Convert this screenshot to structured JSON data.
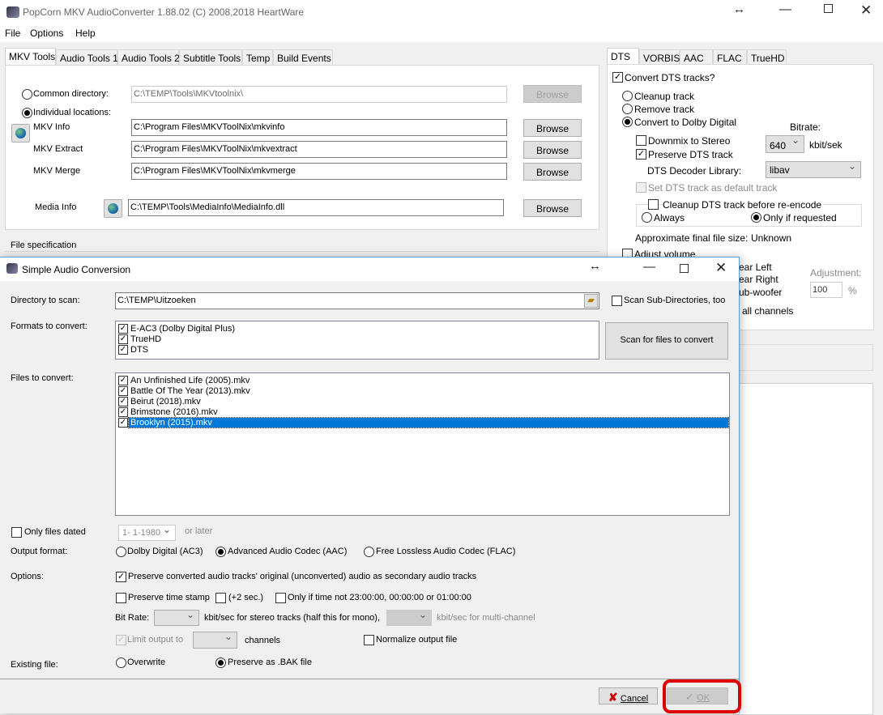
{
  "app": {
    "title": "PopCorn MKV AudioConverter 1.88.02 (C) 2008,2018 HeartWare",
    "menu": [
      "File",
      "Options",
      "Help"
    ]
  },
  "left_tabs": [
    "MKV Tools",
    "Audio Tools 1",
    "Audio Tools 2",
    "Subtitle Tools",
    "Temp",
    "Build Events"
  ],
  "mkv": {
    "common_label": "Common directory:",
    "common_value": "C:\\TEMP\\Tools\\MKVtoolnix\\",
    "individual_label": "Individual locations:",
    "info_label": "MKV Info",
    "info_value": "C:\\Program Files\\MKVToolNix\\mkvinfo",
    "extract_label": "MKV Extract",
    "extract_value": "C:\\Program Files\\MKVToolNix\\mkvextract",
    "merge_label": "MKV Merge",
    "merge_value": "C:\\Program Files\\MKVToolNix\\mkvmerge",
    "mediainfo_label": "Media Info",
    "mediainfo_value": "C:\\TEMP\\Tools\\MediaInfo\\MediaInfo.dll",
    "browse": "Browse"
  },
  "file_spec": "File specification",
  "right_tabs": [
    "DTS",
    "VORBIS",
    "AAC",
    "FLAC",
    "TrueHD"
  ],
  "dts": {
    "convert": "Convert DTS tracks?",
    "cleanup": "Cleanup track",
    "remove": "Remove track",
    "to_dd": "Convert to Dolby Digital",
    "bitrate_label": "Bitrate:",
    "downmix": "Downmix to Stereo",
    "bitrate": "640",
    "unit": "kbit/sek",
    "preserve": "Preserve DTS track",
    "decoder_label": "DTS Decoder Library:",
    "decoder": "libav",
    "set_default": "Set DTS track as default track",
    "cleanup_before": "Cleanup DTS track before re-encode",
    "always": "Always",
    "only_req": "Only if requested",
    "approx_label": "Approximate final file size:",
    "approx": "Unknown",
    "adjust": "Adjust volume",
    "rear_left": "ear Left",
    "rear_right": "ear Right",
    "sub": "ub-woofer",
    "all": "all channels",
    "adjustment": "Adjustment:",
    "adj_value": "100",
    "pct": "%"
  },
  "dialog": {
    "title": "Simple Audio Conversion",
    "dir_label": "Directory to scan:",
    "dir_value": "C:\\TEMP\\Uitzoeken",
    "scan_sub": "Scan Sub-Directories, too",
    "formats_label": "Formats to convert:",
    "formats": [
      "E-AC3 (Dolby Digital Plus)",
      "TrueHD",
      "DTS"
    ],
    "scan_button": "Scan for files to convert",
    "files_label": "Files to convert:",
    "files": [
      "An Unfinished Life (2005).mkv",
      "Battle Of The Year (2013).mkv",
      "Beirut (2018).mkv",
      "Brimstone (2016).mkv",
      "Brooklyn (2015).mkv"
    ],
    "only_dated": "Only files dated",
    "date": "1- 1-1980",
    "or_later": "or later",
    "output_label": "Output format:",
    "out_ac3": "Dolby Digital (AC3)",
    "out_aac": "Advanced Audio Codec (AAC)",
    "out_flac": "Free Lossless Audio Codec (FLAC)",
    "options_label": "Options:",
    "preserve_orig": "Preserve converted audio tracks' original (unconverted) audio as secondary audio tracks",
    "preserve_ts": "Preserve time stamp",
    "plus2": "(+2 sec.)",
    "only_time": "Only if time not 23:00:00, 00:00:00 or 01:00:00",
    "bitrate_label": "Bit Rate:",
    "stereo_text": "kbit/sec for stereo tracks (half this for mono),",
    "multi_text": "kbit/sec for multi-channel",
    "limit": "Limit output to",
    "channels": "channels",
    "normalize": "Normalize output file",
    "existing_label": "Existing file:",
    "overwrite": "Overwrite",
    "bak": "Preserve as .BAK file",
    "cancel": "Cancel",
    "ok": "OK"
  },
  "colors": {
    "selection": "#0078d7",
    "highlight": "#e00000"
  }
}
